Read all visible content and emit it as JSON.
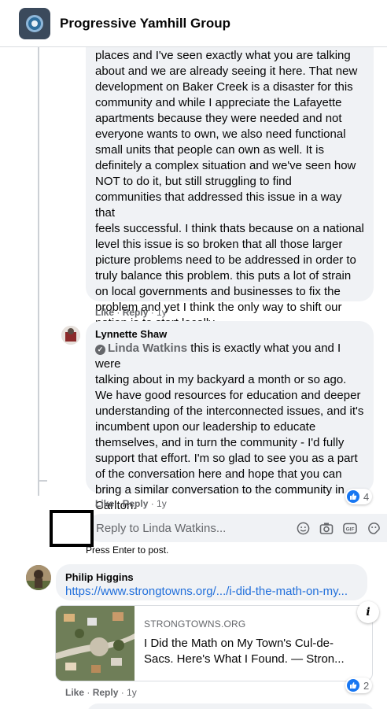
{
  "header": {
    "group_name": "Progressive Yamhill Group"
  },
  "comment_1": {
    "lines": [
      "places and I've seen exactly what you are talking",
      "about and we are already seeing it here. That new",
      "development on Baker Creek is a disaster for this",
      "community and while I appreciate the Lafayette",
      "apartments because they were needed and not",
      "everyone wants to own, we also need functional",
      "small units that people can own as well. It is",
      "definitely a complex situation and we've seen how",
      "NOT to do it, but still struggling to find",
      "communities that addressed this issue in a way that",
      "feels successful. I think thats because on a national",
      "level this issue is so broken that all those larger",
      "picture problems need to be addressed in order to",
      "truly balance this problem. this puts a lot of strain",
      "on local governments and businesses to fix the",
      "problem and yet I think the only way to shift our",
      "nation is to start locally."
    ],
    "like": "Like",
    "reply": "Reply",
    "time": "1y"
  },
  "comment_2": {
    "author": "Lynnette Shaw",
    "mention": "Linda Watkins",
    "first_line_rest": " this is exactly what you and I were",
    "lines": [
      "talking about in my backyard a month or so ago.",
      "We have good resources for education and deeper",
      "understanding of the interconnected issues, and it's",
      "incumbent upon our leadership to educate",
      "themselves, and in turn the community - I'd fully",
      "support that effort. I'm so glad to see you as a part",
      "of the conversation here and hope that you can",
      "bring a similar conversation to the community in",
      "Carlton."
    ],
    "like": "Like",
    "reply": "Reply",
    "time": "1y",
    "reaction_count": "4"
  },
  "reply_box": {
    "placeholder": "Reply to Linda Watkins...",
    "hint": "Press Enter to post."
  },
  "comment_3": {
    "author": "Philip Higgins",
    "link_text": "https://www.strongtowns.org/.../i-did-the-math-on-my...",
    "card_domain": "STRONGTOWNS.ORG",
    "card_title_1": "I Did the Math on My Town's Cul-de-",
    "card_title_2": "Sacs. Here's What I Found. — Stron...",
    "info": "i",
    "like": "Like",
    "reply": "Reply",
    "time": "1y",
    "reaction_count": "2"
  },
  "colors": {
    "accent": "#1877f2",
    "link": "#216fdb",
    "muted": "#65676b",
    "bubble": "#f0f2f5"
  },
  "icons": [
    "like-icon",
    "emoji-icon",
    "camera-icon",
    "gif-icon",
    "sticker-icon",
    "verified-icon",
    "info-icon"
  ]
}
